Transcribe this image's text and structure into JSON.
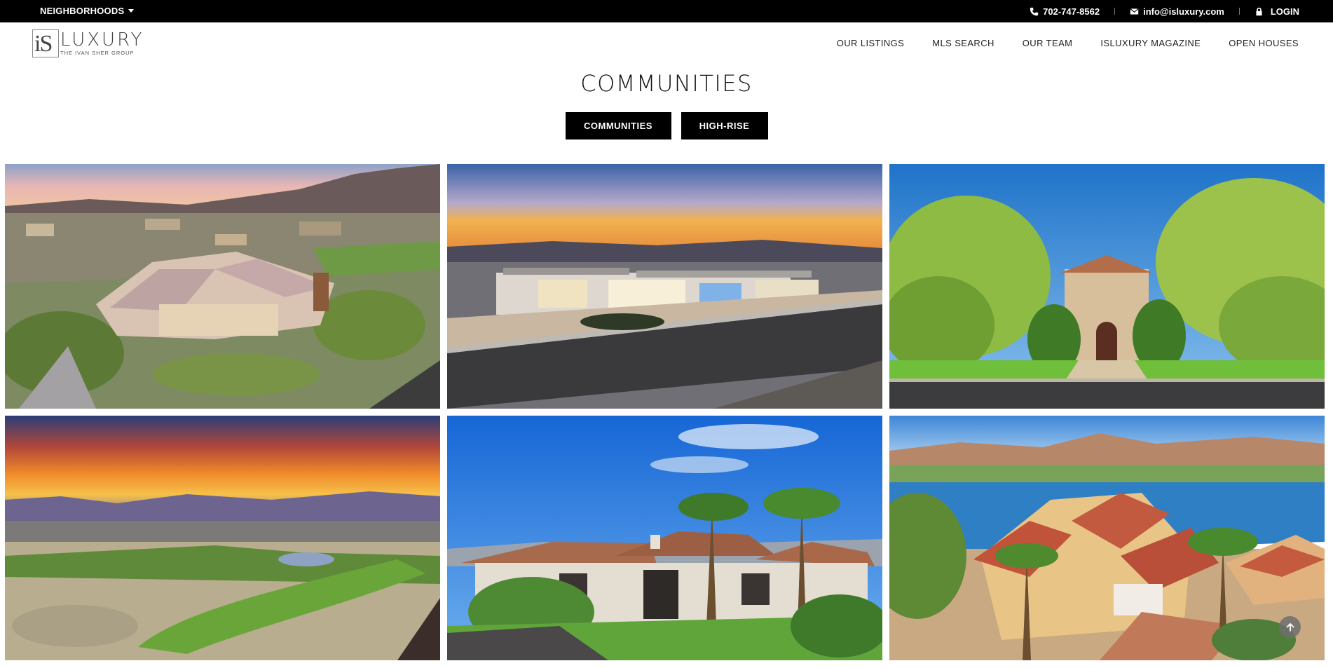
{
  "topbar": {
    "neighborhoods_label": "NEIGHBORHOODS",
    "phone": "702-747-8562",
    "email": "info@isluxury.com",
    "login": "LOGIN"
  },
  "logo": {
    "mark": "iS",
    "word": "LUXURY",
    "sub": "THE IVAN SHER GROUP"
  },
  "nav": {
    "items": [
      "OUR LISTINGS",
      "MLS SEARCH",
      "OUR TEAM",
      "ISLUXURY MAGAZINE",
      "OPEN HOUSES"
    ]
  },
  "page": {
    "title": "COMMUNITIES"
  },
  "filters": {
    "communities": "COMMUNITIES",
    "high_rise": "HIGH-RISE"
  },
  "tiles": [
    {
      "scene": "aerial-estate-mountains-dusk"
    },
    {
      "scene": "modern-home-twilight-road"
    },
    {
      "scene": "mediterranean-entry-trees"
    },
    {
      "scene": "golf-course-sunset"
    },
    {
      "scene": "tile-roof-estate-palms"
    },
    {
      "scene": "lakefront-villa-aerial"
    }
  ],
  "icons": {
    "phone": "phone-icon",
    "email": "envelope-icon",
    "login": "lock-icon",
    "back_to_top": "arrow-up-icon"
  }
}
